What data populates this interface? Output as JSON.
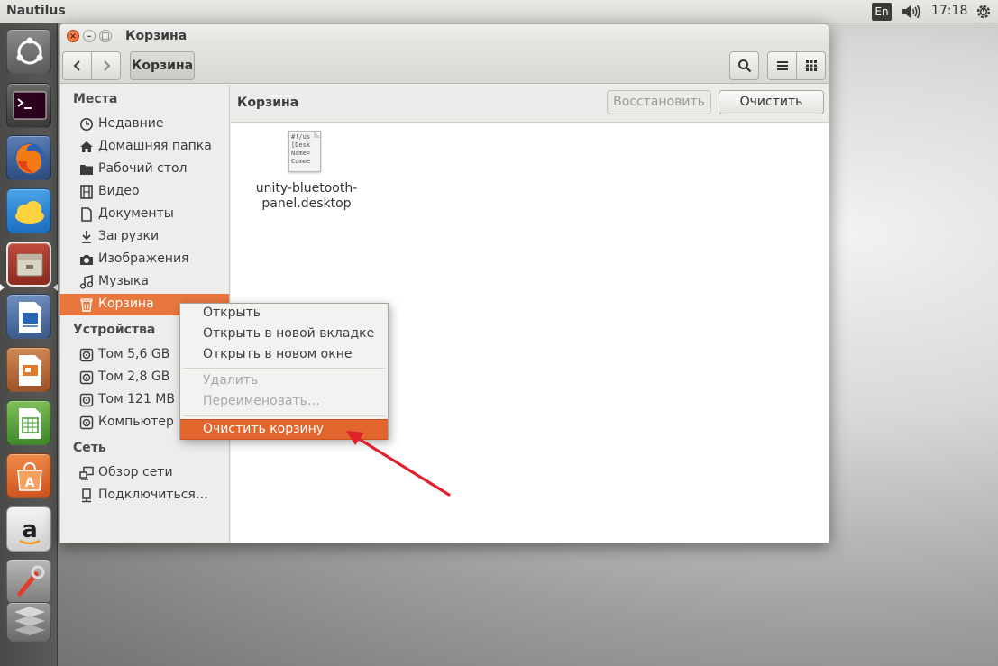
{
  "top_panel": {
    "app_title": "Nautilus",
    "keyboard_layout": "En",
    "clock": "17:18"
  },
  "window": {
    "title": "Корзина",
    "path_button": "Корзина",
    "content_title": "Корзина",
    "restore_label": "Восстановить",
    "empty_label": "Очистить"
  },
  "sidebar": {
    "sections": [
      {
        "heading": "Места",
        "items": [
          {
            "label": "Недавние",
            "icon": "clock-icon"
          },
          {
            "label": "Домашняя папка",
            "icon": "home-icon"
          },
          {
            "label": "Рабочий стол",
            "icon": "folder-icon"
          },
          {
            "label": "Видео",
            "icon": "film-icon"
          },
          {
            "label": "Документы",
            "icon": "document-icon"
          },
          {
            "label": "Загрузки",
            "icon": "download-icon"
          },
          {
            "label": "Изображения",
            "icon": "camera-icon"
          },
          {
            "label": "Музыка",
            "icon": "music-icon"
          },
          {
            "label": "Корзина",
            "icon": "trash-icon",
            "active": true
          }
        ]
      },
      {
        "heading": "Устройства",
        "items": [
          {
            "label": "Том 5,6 GB",
            "icon": "drive-icon"
          },
          {
            "label": "Том 2,8 GB",
            "icon": "drive-icon"
          },
          {
            "label": "Том 121 MB",
            "icon": "drive-icon"
          },
          {
            "label": "Компьютер",
            "icon": "drive-icon"
          }
        ]
      },
      {
        "heading": "Сеть",
        "items": [
          {
            "label": "Обзор сети",
            "icon": "network-icon"
          },
          {
            "label": "Подключиться…",
            "icon": "connect-icon"
          }
        ]
      }
    ]
  },
  "files": [
    {
      "name": "unity-bluetooth-panel.desktop",
      "name_line1": "unity-bluetooth-",
      "name_line2": "panel.desktop",
      "preview": "#!/us\n[Desk\nName=\nComme"
    }
  ],
  "context_menu": {
    "items": [
      {
        "label": "Открыть",
        "enabled": true
      },
      {
        "label": "Открыть в новой вкладке",
        "enabled": true
      },
      {
        "label": "Открыть в новом окне",
        "enabled": true
      },
      {
        "label": "Удалить",
        "enabled": false
      },
      {
        "label": "Переименовать…",
        "enabled": false
      },
      {
        "label": "Очистить корзину",
        "enabled": true,
        "highlighted": true
      }
    ]
  },
  "launcher": {
    "apps": [
      "dash-icon",
      "terminal-icon",
      "firefox-icon",
      "cloud-icon",
      "file-manager-icon",
      "writer-icon",
      "impress-icon",
      "calc-icon",
      "software-center-icon",
      "amazon-icon",
      "settings-icon",
      "workspaces-icon"
    ]
  },
  "colors": {
    "accent": "#e1652c",
    "sidebar_active": "#e8773e",
    "annotation_arrow": "#e0202a"
  }
}
